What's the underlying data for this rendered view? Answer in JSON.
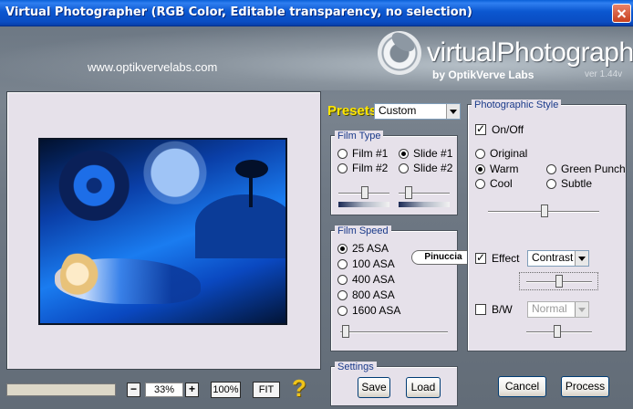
{
  "window": {
    "title": "Virtual Photographer (RGB Color, Editable transparency, no selection)"
  },
  "header": {
    "url": "www.optikvervelabs.com",
    "logo_text": "virtualPhotographer",
    "logo_sub": "by OptikVerve Labs",
    "version": "ver 1.44v"
  },
  "zoom": {
    "minus": "−",
    "value": "33%",
    "plus": "+",
    "full": "100%",
    "fit": "FIT",
    "help": "?"
  },
  "presets": {
    "label": "Presets",
    "value": "Custom"
  },
  "film_type": {
    "label": "Film Type",
    "options": [
      "Film #1",
      "Slide #1",
      "Film #2",
      "Slide #2"
    ],
    "selected": "Slide #1"
  },
  "film_speed": {
    "label": "Film Speed",
    "options": [
      "25 ASA",
      "100 ASA",
      "400 ASA",
      "800 ASA",
      "1600 ASA"
    ],
    "selected": "25 ASA"
  },
  "badge": "Pinuccia",
  "settings": {
    "label": "Settings",
    "save": "Save",
    "load": "Load"
  },
  "photo_style": {
    "label": "Photographic Style",
    "onoff": "On/Off",
    "onoff_checked": true,
    "options": [
      "Original",
      "Warm",
      "Green Punch",
      "Cool",
      "Subtle"
    ],
    "selected": "Warm",
    "effect_label": "Effect",
    "effect_checked": true,
    "effect_value": "Contrast",
    "bw_label": "B/W",
    "bw_checked": false,
    "bw_value": "Normal"
  },
  "actions": {
    "cancel": "Cancel",
    "process": "Process"
  }
}
